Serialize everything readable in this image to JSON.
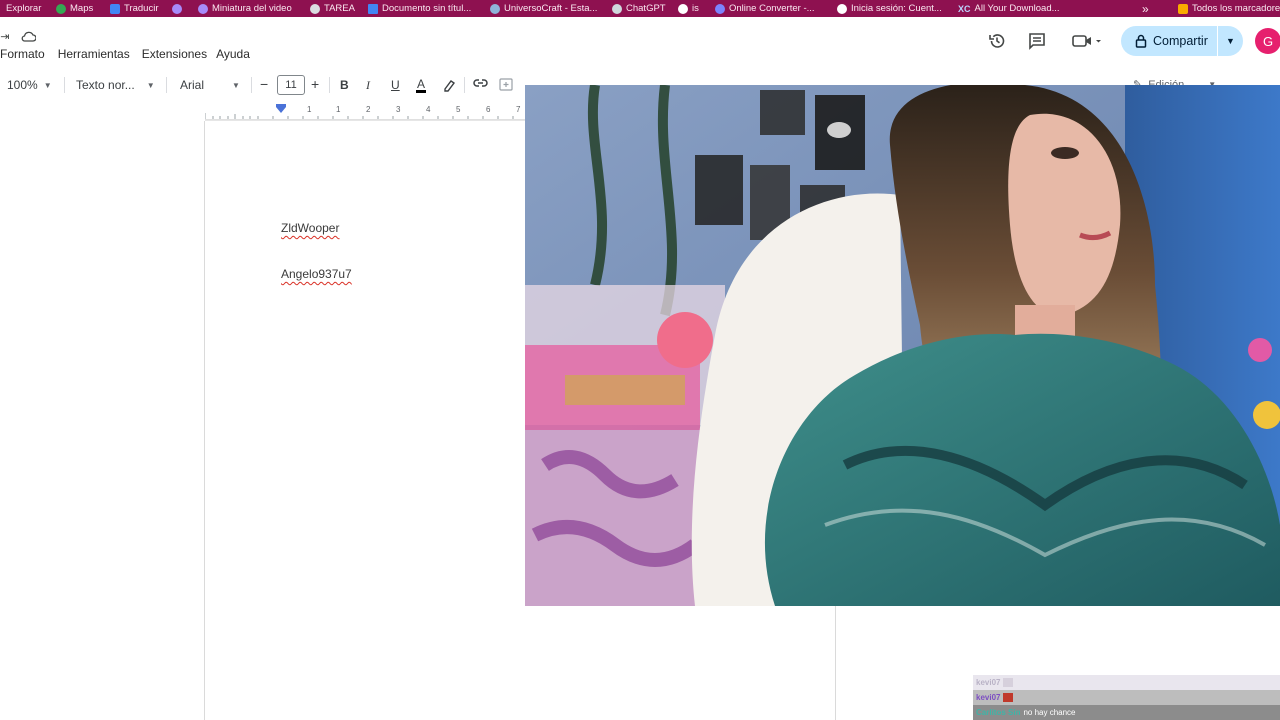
{
  "bookmarks": [
    {
      "label": "Explorar",
      "color": "#f5c542"
    },
    {
      "label": "Maps",
      "color": "#34a853"
    },
    {
      "label": "Traducir",
      "color": "#4285f4"
    },
    {
      "label": "",
      "color": "#7b61ff"
    },
    {
      "label": "Miniatura del video",
      "color": "#7b61ff"
    },
    {
      "label": "TAREA",
      "color": "#9aa0a6"
    },
    {
      "label": "Documento sin títul...",
      "color": "#4285f4"
    },
    {
      "label": "UniversoCraft - Esta...",
      "color": "#5f8fbf"
    },
    {
      "label": "ChatGPT",
      "color": "#10a37f"
    },
    {
      "label": "is",
      "color": "#202124"
    },
    {
      "label": "Online Converter -...",
      "color": "#6a5acd"
    },
    {
      "label": "Inicia sesión: Cuent...",
      "color": "#ffffff"
    },
    {
      "label": "All Your Download...",
      "color": "#0b57d0"
    },
    {
      "label": "Todos los marcadores",
      "color": "#f9ab00"
    }
  ],
  "bookmarks_overflow": "»",
  "menu": [
    "Formato",
    "Herramientas",
    "Extensiones",
    "Ayuda"
  ],
  "header": {
    "share_label": "Compartir",
    "avatar_letter": "G",
    "icons": [
      "history-icon",
      "comment-icon",
      "meet-icon",
      "lock-icon",
      "cloud-icon"
    ]
  },
  "toolbar": {
    "zoom": "100%",
    "style": "Texto nor...",
    "font": "Arial",
    "font_size": "11",
    "minus": "−",
    "plus": "+",
    "bold": "B",
    "italic": "I",
    "underline": "U",
    "text_color": "A",
    "mode": "Edición"
  },
  "ruler": {
    "marks": [
      "1",
      "1",
      "2",
      "3",
      "4",
      "5",
      "6",
      "7",
      "8"
    ]
  },
  "document": {
    "lines": [
      "ZldWooper",
      "Angelo937u7"
    ]
  },
  "chat": {
    "messages": [
      {
        "user": "kevi07",
        "text": ""
      },
      {
        "user": "kevi07",
        "text": ""
      },
      {
        "user": "Carlitos Sin",
        "text": "no hay chance"
      }
    ]
  },
  "colors": {
    "bookmark_bar": "#8e1150",
    "share": "#c2e7ff",
    "avatar": "#e6206e"
  }
}
